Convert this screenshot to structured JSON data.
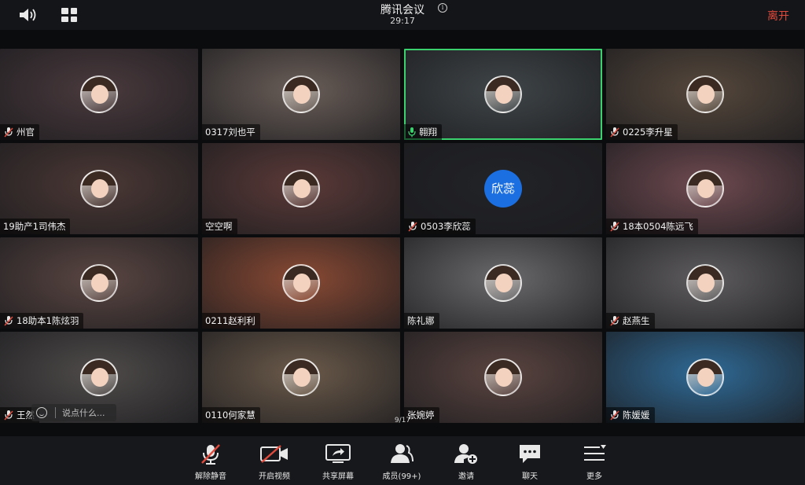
{
  "header": {
    "title": "腾讯会议",
    "timer": "29:17",
    "leave_label": "离开",
    "info_glyph": "i"
  },
  "participants": [
    {
      "name": "州官",
      "mic": "muted",
      "avatar": "photo",
      "bg": "#4a3a3d"
    },
    {
      "name": "0317刘也平",
      "mic": "none",
      "avatar": "photo",
      "bg": "#6a5e58"
    },
    {
      "name": "翱翔",
      "mic": "active",
      "avatar": "photo",
      "bg": "#3f4548"
    },
    {
      "name": "0225李升星",
      "mic": "muted",
      "avatar": "photo",
      "bg": "#56483c"
    },
    {
      "name": "19助产1司伟杰",
      "mic": "none",
      "avatar": "photo",
      "bg": "#4b3835"
    },
    {
      "name": "空空啊",
      "mic": "none",
      "avatar": "photo",
      "bg": "#5b3a38"
    },
    {
      "name": "0503李欣蕊",
      "mic": "muted",
      "avatar": "text",
      "avatar_text": "欣蕊",
      "bg": "#222327"
    },
    {
      "name": "18本0504陈远飞",
      "mic": "muted",
      "avatar": "photo",
      "bg": "#6e4a50"
    },
    {
      "name": "18助本1陈炫羽",
      "mic": "muted",
      "avatar": "photo",
      "bg": "#5a4642"
    },
    {
      "name": "0211赵利利",
      "mic": "none",
      "avatar": "photo",
      "bg": "#8a4a34"
    },
    {
      "name": "陈礼娜",
      "mic": "none",
      "avatar": "photo",
      "bg": "#6a6a6c"
    },
    {
      "name": "赵燕生",
      "mic": "muted",
      "avatar": "photo",
      "bg": "#5e5c5e"
    },
    {
      "name": "王然",
      "mic": "muted",
      "avatar": "photo",
      "bg": "#4f4b4a"
    },
    {
      "name": "0110何家慧",
      "mic": "none",
      "avatar": "photo",
      "bg": "#6b5a4a"
    },
    {
      "name": "张婉婷",
      "mic": "none",
      "avatar": "photo",
      "bg": "#5a4440"
    },
    {
      "name": "陈媛媛",
      "mic": "muted",
      "avatar": "photo",
      "bg": "#2f6a96"
    }
  ],
  "chat": {
    "placeholder": "说点什么..."
  },
  "pagination": {
    "indicator": "9/17"
  },
  "toolbar": {
    "unmute_label": "解除静音",
    "start_video_label": "开启视频",
    "share_screen_label": "共享屏幕",
    "members_label": "成员(99+)",
    "invite_label": "邀请",
    "chat_label": "聊天",
    "more_label": "更多"
  },
  "colors": {
    "active_speaker_border": "#3bd16f",
    "leave": "#e04a3c",
    "mic_muted": "#e04a3c",
    "mic_active": "#3bd16f",
    "text_avatar_bg": "#1c6fe0"
  }
}
